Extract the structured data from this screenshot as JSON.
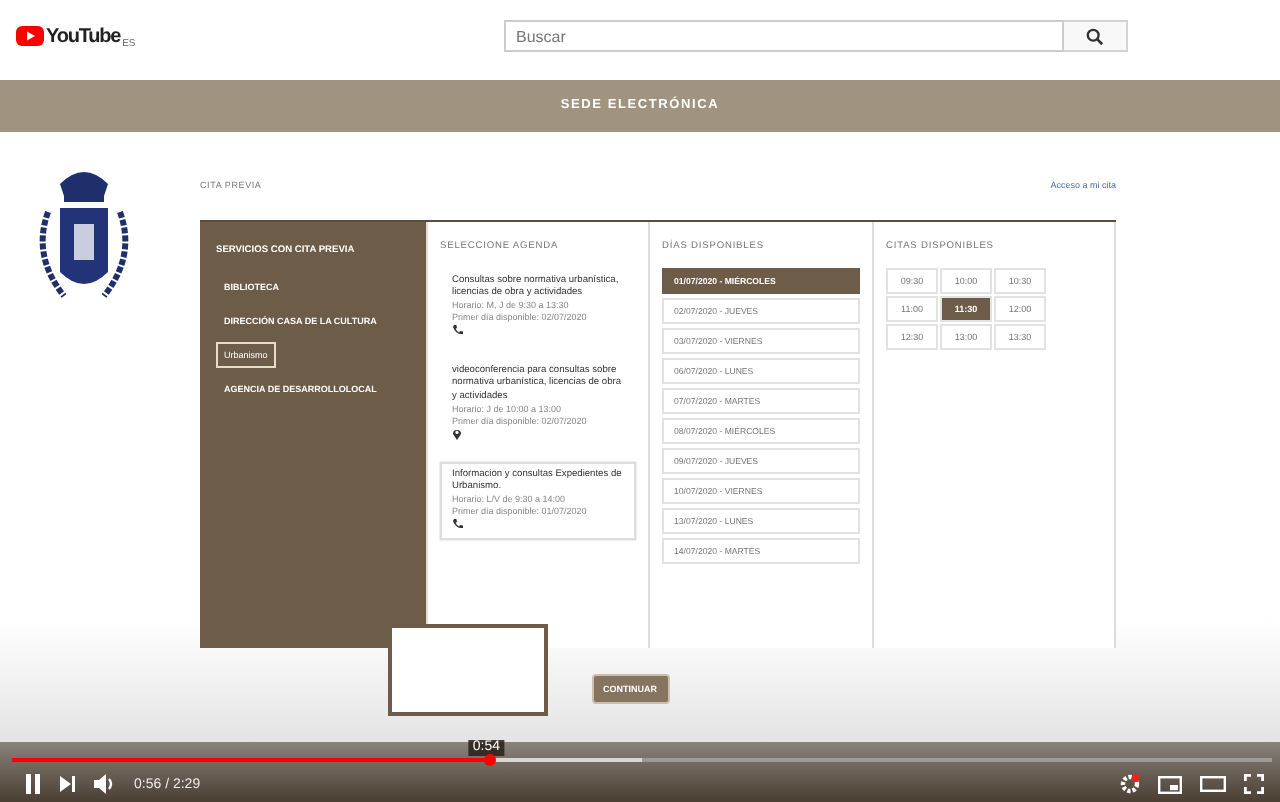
{
  "header": {
    "logo_text": "YouTube",
    "region": "ES",
    "search": {
      "placeholder": "Buscar"
    }
  },
  "site": {
    "banner": "SEDE ELECTRÓNICA",
    "breadcrumb": "CITA PREVIA",
    "access_link": "Acceso a mi cita"
  },
  "services": {
    "title": "SERVICIOS CON CITA PREVIA",
    "items": [
      {
        "label": "BIBLIOTECA",
        "selected": false
      },
      {
        "label": "DIRECCIÓN CASA DE LA CULTURA",
        "selected": false
      },
      {
        "label": "Urbanismo",
        "selected": true
      },
      {
        "label": "AGENCIA DE DESARROLLOLOCAL",
        "selected": false
      }
    ]
  },
  "agendas": {
    "title": "SELECCIONE AGENDA",
    "items": [
      {
        "title": "Consultas sobre normativa urbanística, licencias de obra y actividades",
        "schedule": "Horario: M, J de 9:30 a 13:30",
        "first_day": "Primer día disponible: 02/07/2020",
        "kind": "phone",
        "selected": false
      },
      {
        "title": "videoconferencia para consultas sobre normativa urbanística, licencias de obra y actividades",
        "schedule": "Horario: J de 10:00 a 13:00",
        "first_day": "Primer día disponible: 02/07/2020",
        "kind": "location",
        "selected": false
      },
      {
        "title": "Informacion y consultas Expedientes de Urbanismo.",
        "schedule": "Horario: L/V de 9:30 a 14:00",
        "first_day": "Primer día disponible: 01/07/2020",
        "kind": "phone",
        "selected": true
      }
    ]
  },
  "days": {
    "title": "DÍAS DISPONIBLES",
    "items": [
      {
        "label": "01/07/2020 - MIÉRCOLES",
        "selected": true
      },
      {
        "label": "02/07/2020 - JUEVES",
        "selected": false
      },
      {
        "label": "03/07/2020 - VIERNES",
        "selected": false
      },
      {
        "label": "06/07/2020 - LUNES",
        "selected": false
      },
      {
        "label": "07/07/2020 - MARTES",
        "selected": false
      },
      {
        "label": "08/07/2020 - MIÉRCOLES",
        "selected": false
      },
      {
        "label": "09/07/2020 - JUEVES",
        "selected": false
      },
      {
        "label": "10/07/2020 - VIERNES",
        "selected": false
      },
      {
        "label": "13/07/2020 - LUNES",
        "selected": false
      },
      {
        "label": "14/07/2020 - MARTES",
        "selected": false
      }
    ]
  },
  "slots": {
    "title": "CITAS DISPONIBLES",
    "items": [
      {
        "label": "09:30",
        "selected": false
      },
      {
        "label": "10:00",
        "selected": false
      },
      {
        "label": "10:30",
        "selected": false
      },
      {
        "label": "11:00",
        "selected": false
      },
      {
        "label": "11:30",
        "selected": true
      },
      {
        "label": "12:00",
        "selected": false
      },
      {
        "label": "12:30",
        "selected": false
      },
      {
        "label": "13:00",
        "selected": false
      },
      {
        "label": "13:30",
        "selected": false
      }
    ]
  },
  "continue_button": "CONTINUAR",
  "player": {
    "level": 0.38,
    "hover_time": "0:54",
    "time": "0:56 / 2:29"
  }
}
